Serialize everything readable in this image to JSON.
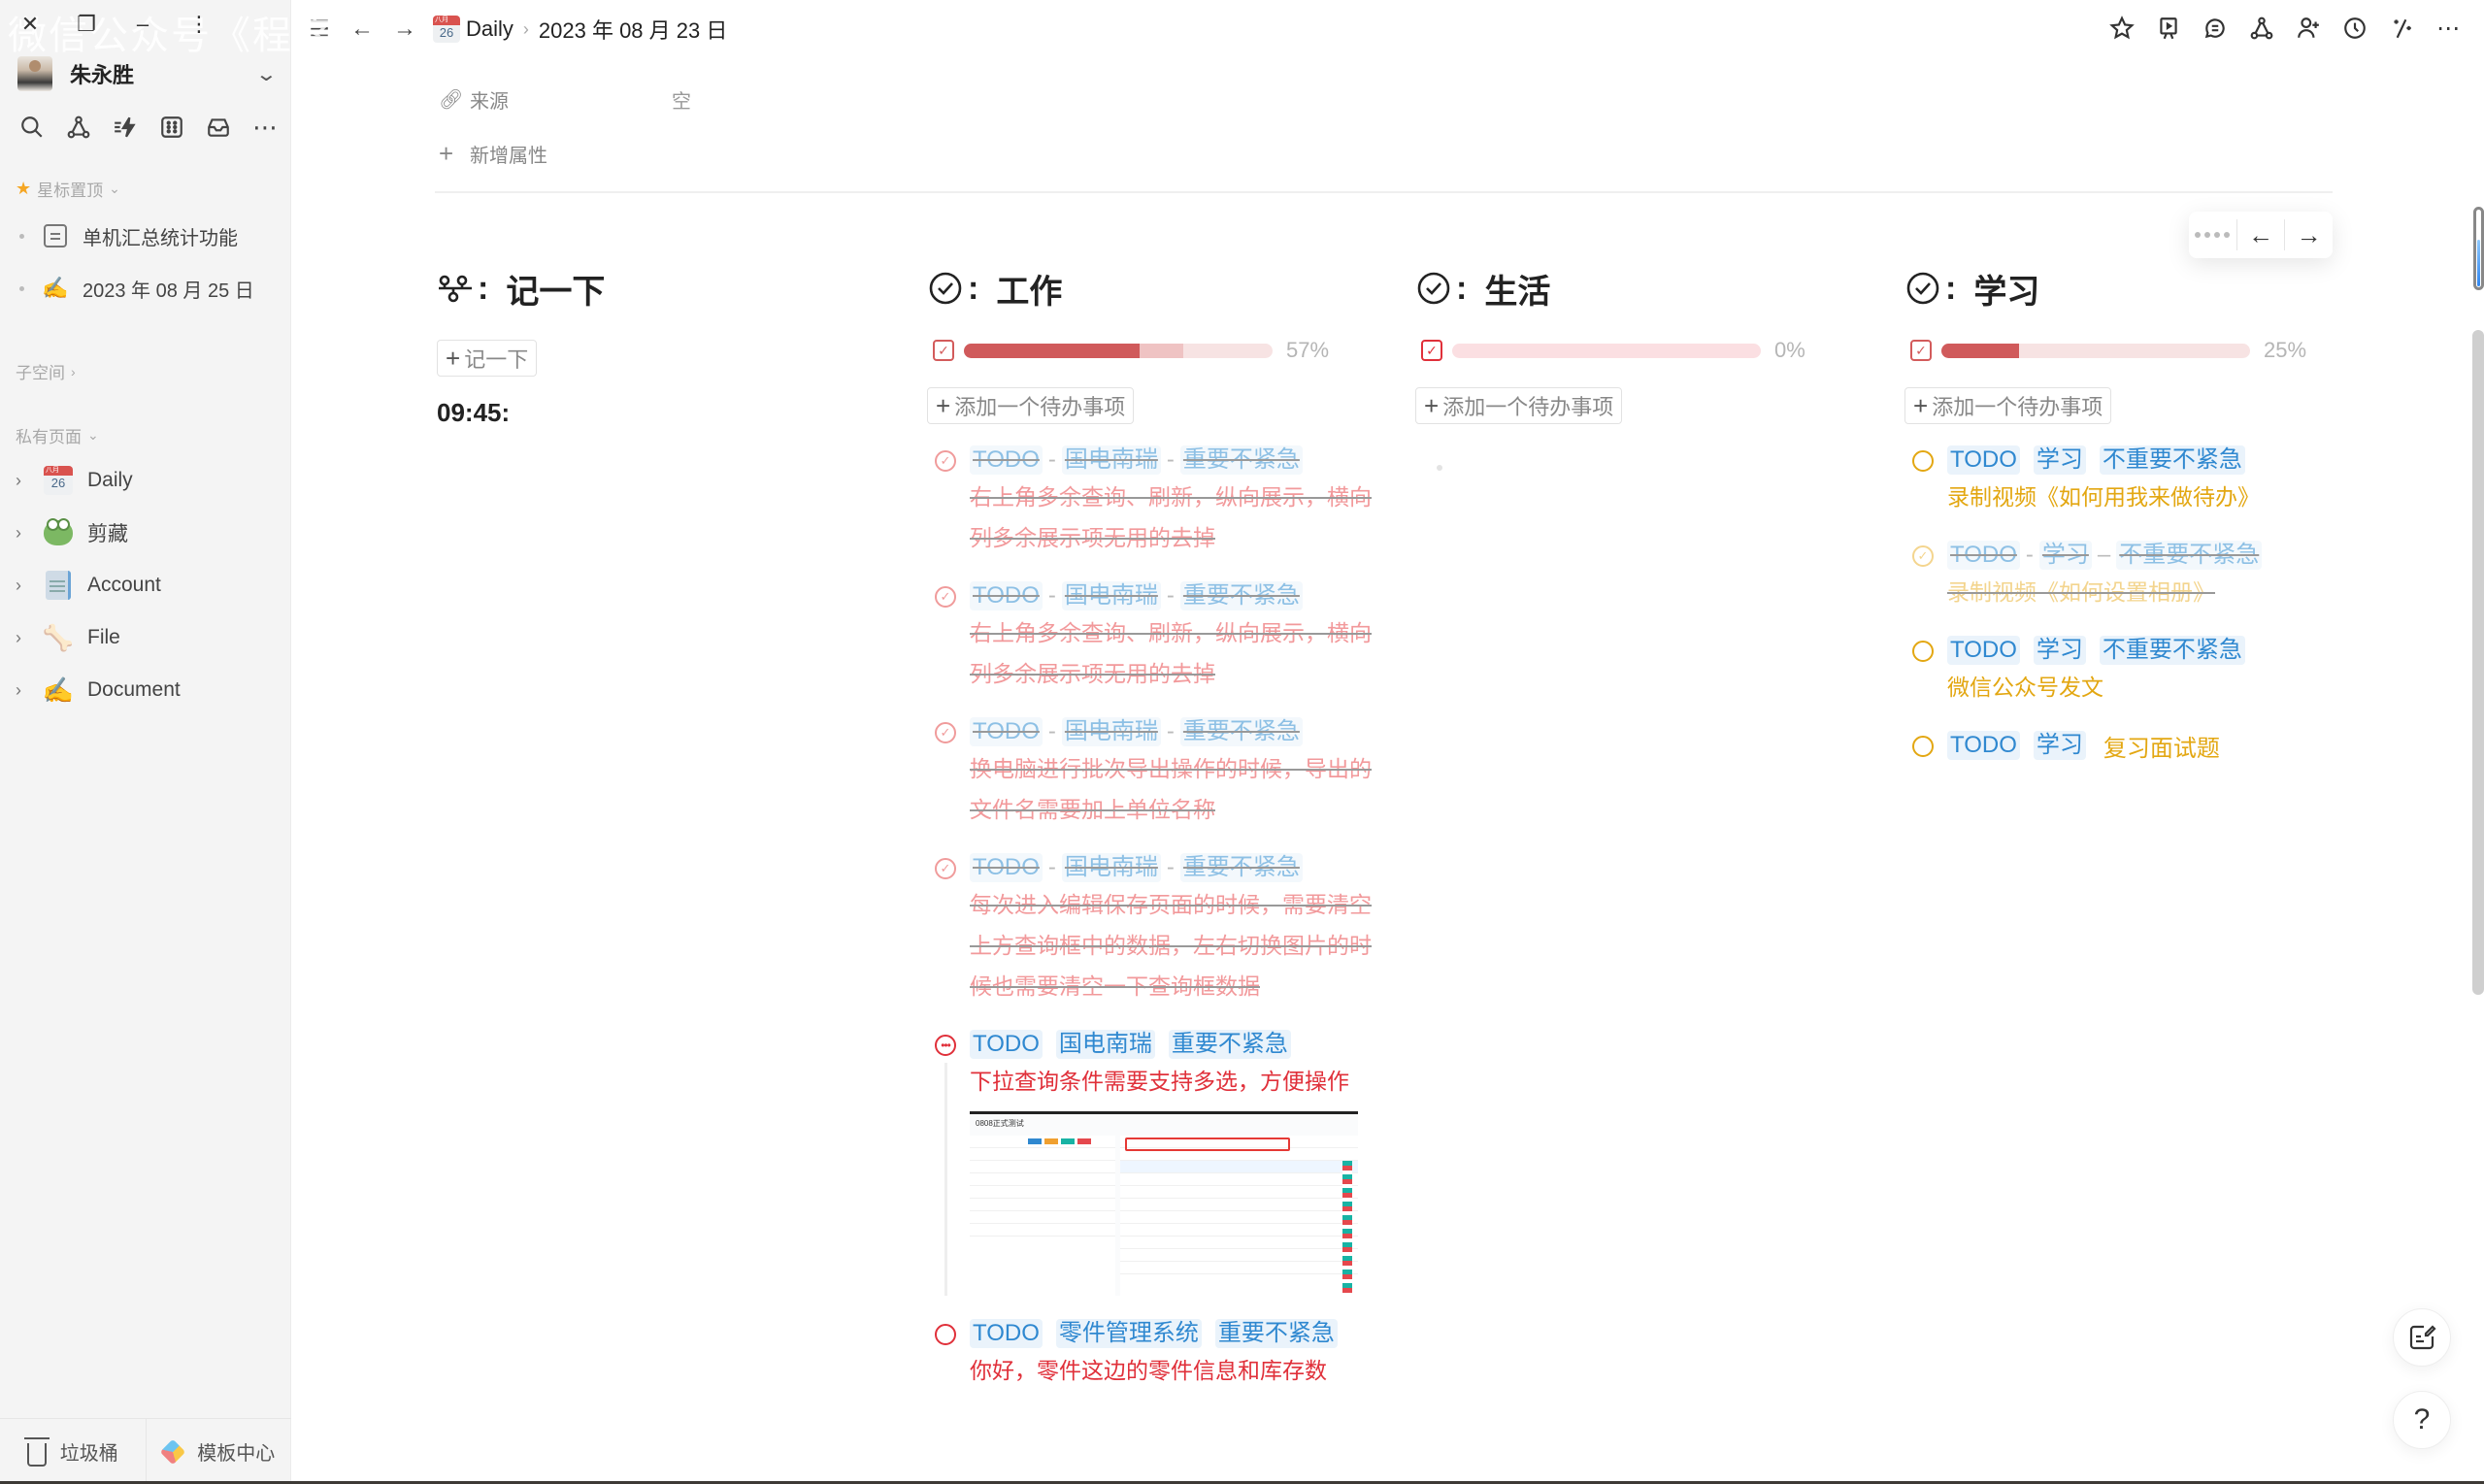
{
  "watermark": "微信公众号《程序",
  "window_controls": [
    "close-icon",
    "restore-icon",
    "minimize-icon",
    "more-vertical-icon"
  ],
  "sidebar": {
    "user_name": "朱永胜",
    "tool_icons": [
      "search-icon",
      "graph-icon",
      "quick-action-icon",
      "template-grid-icon",
      "inbox-icon",
      "more-icon"
    ],
    "favorites_label": "星标置顶",
    "favorites": [
      {
        "label": "单机汇总统计功能",
        "icon": "document-icon"
      },
      {
        "label": "2023 年 08 月 25 日",
        "icon": "writing-hand-emoji",
        "emoji": "✍️"
      }
    ],
    "subspace_label": "子空间",
    "private_label": "私有页面",
    "pages": [
      {
        "label": "Daily",
        "icon": "calendar-emoji",
        "cal_month": "八月",
        "cal_day": "26"
      },
      {
        "label": "剪藏",
        "icon": "frog-emoji"
      },
      {
        "label": "Account",
        "icon": "notepad-emoji"
      },
      {
        "label": "File",
        "icon": "bone-emoji",
        "emoji": "🦴"
      },
      {
        "label": "Document",
        "icon": "writing-hand-emoji",
        "emoji": "✍️"
      }
    ],
    "trash_label": "垃圾桶",
    "template_label": "模板中心"
  },
  "topbar": {
    "breadcrumb": [
      {
        "label": "Daily",
        "icon": "calendar-emoji",
        "cal_month": "八月",
        "cal_day": "26"
      },
      {
        "label": "2023 年 08 月 23 日"
      }
    ],
    "action_icons": [
      "star-icon",
      "presentation-icon",
      "comment-icon",
      "share-graph-icon",
      "add-member-icon",
      "history-icon",
      "ai-magic-icon",
      "more-icon"
    ]
  },
  "properties": {
    "source_label": "来源",
    "source_value": "空",
    "add_property_label": "新增属性"
  },
  "float_nav": {
    "prev": "←",
    "next": "→"
  },
  "columns": {
    "note": {
      "title": "记一下",
      "add_label": "记一下",
      "time": "09:45:"
    },
    "work": {
      "title": "工作",
      "progress_done_pct": 57,
      "progress_doing_pct": 14,
      "progress_label": "57%",
      "add_label": "添加一个待办事项",
      "items": [
        {
          "status": "done",
          "tags": [
            "TODO",
            "国电南瑞",
            "重要不紧急"
          ],
          "text": "右上角多余查询、刷新，纵向展示，横向列多余展示项无用的去掉"
        },
        {
          "status": "done",
          "tags": [
            "TODO",
            "国电南瑞",
            "重要不紧急"
          ],
          "text": "右上角多余查询、刷新，纵向展示，横向列多余展示项无用的去掉"
        },
        {
          "status": "done",
          "tags": [
            "TODO",
            "国电南瑞",
            "重要不紧急"
          ],
          "text": "换电脑进行批次导出操作的时候，导出的文件名需要加上单位名称"
        },
        {
          "status": "done",
          "tags": [
            "TODO",
            "国电南瑞",
            "重要不紧急"
          ],
          "text": "每次进入编辑保存页面的时候，需要清空上方查询框中的数据，左右切换图片的时候也需要清空一下查询框数据"
        },
        {
          "status": "in-progress",
          "tags": [
            "TODO",
            "国电南瑞",
            "重要不紧急"
          ],
          "text": "下拉查询条件需要支持多选，方便操作",
          "screenshot_title": "0808正式测试"
        },
        {
          "status": "todo",
          "tags": [
            "TODO",
            "零件管理系统",
            "重要不紧急"
          ],
          "text": "你好，零件这边的零件信息和库存数"
        }
      ]
    },
    "life": {
      "title": "生活",
      "progress_done_pct": 0,
      "progress_label": "0%",
      "add_label": "添加一个待办事项"
    },
    "study": {
      "title": "学习",
      "progress_done_pct": 25,
      "progress_label": "25%",
      "add_label": "添加一个待办事项",
      "items": [
        {
          "status": "todo",
          "tags": [
            "TODO",
            "学习",
            "不重要不紧急"
          ],
          "text": "录制视频《如何用我来做待办》"
        },
        {
          "status": "done",
          "tags": [
            "TODO",
            "学习",
            "不重要不紧急"
          ],
          "text": "录制视频《如何设置相册》"
        },
        {
          "status": "todo",
          "tags": [
            "TODO",
            "学习",
            "不重要不紧急"
          ],
          "text": "微信公众号发文"
        },
        {
          "status": "todo",
          "tags": [
            "TODO",
            "学习"
          ],
          "inline_text": "复习面试题"
        }
      ]
    }
  },
  "colors": {
    "progress_done": "#d05a5b",
    "progress_doing": "#efc3c3",
    "progress_track": "#f7e3e3",
    "tag_text": "#2f88d0",
    "tag_bg": "#eaf3fb",
    "work_text": "#e0303a",
    "study_text": "#e3a712"
  }
}
